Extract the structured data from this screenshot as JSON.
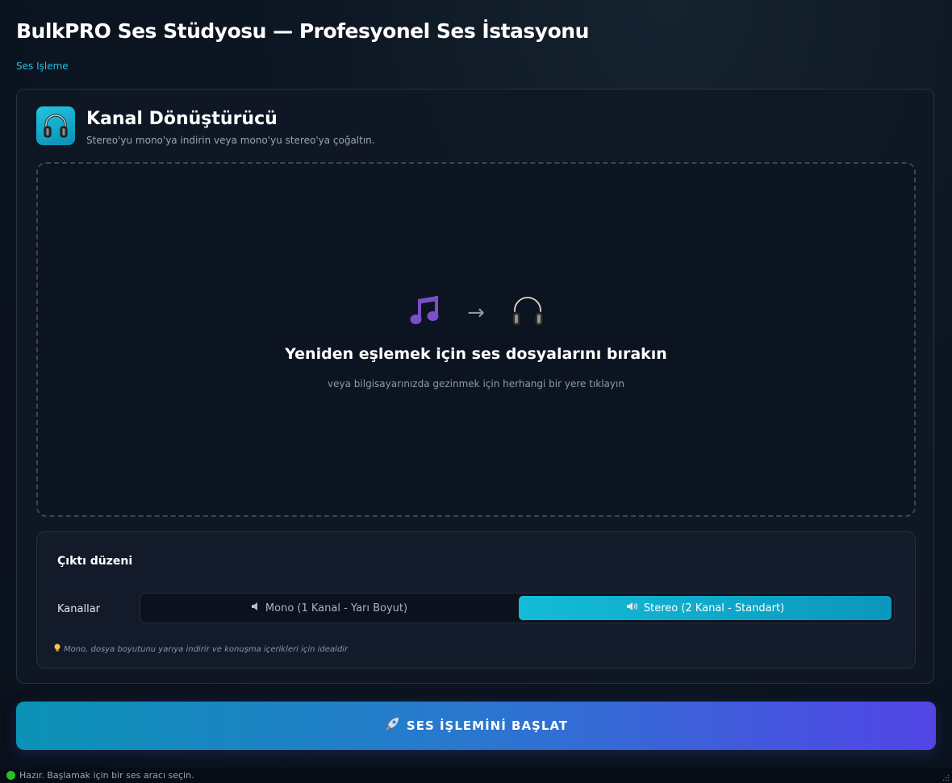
{
  "app": {
    "title": "BulkPRO Ses Stüdyosu — Profesyonel Ses İstasyonu",
    "breadcrumb": "Ses Işleme"
  },
  "tool": {
    "icon": "headphones-icon",
    "title": "Kanal Dönüştürücü",
    "subtitle": "Stereo'yu mono'ya indirin veya mono'yu stereo'ya çoğaltın."
  },
  "dropzone": {
    "icons": [
      "music-note-icon",
      "arrow-right-icon",
      "headphones-icon"
    ],
    "arrow": "→",
    "title": "Yeniden eşlemek için ses dosyalarını bırakın",
    "subtitle": "veya bilgisayarınızda gezinmek için herhangi bir yere tıklayın"
  },
  "settings": {
    "title": "Çıktı düzeni",
    "channels_label": "Kanallar",
    "options": [
      {
        "icon": "speaker-low-icon",
        "label": "Mono (1 Kanal - Yarı Boyut)",
        "selected": false
      },
      {
        "icon": "speaker-high-icon",
        "label": "Stereo (2 Kanal - Standart)",
        "selected": true
      }
    ],
    "hint_icon": "lightbulb-icon",
    "hint": "Mono, dosya boyutunu yarıya indirir ve konuşma içerikleri için idealdir"
  },
  "start_button": {
    "icon": "rocket-icon",
    "label": "SES İŞLEMİNİ BAŞLAT"
  },
  "status": {
    "indicator_color": "#24c224",
    "text": "Hazır. Başlamak için bir ses aracı seçin."
  },
  "colors": {
    "accent": "#14bcd8",
    "background": "#0b1320",
    "button_gradient_end": "#5245e6"
  }
}
